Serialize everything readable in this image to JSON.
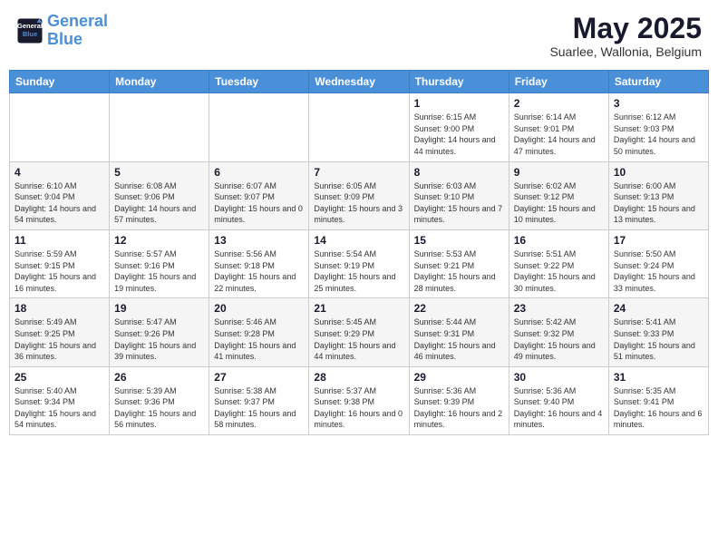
{
  "logo": {
    "line1": "General",
    "line2": "Blue"
  },
  "title": "May 2025",
  "subtitle": "Suarlee, Wallonia, Belgium",
  "headers": [
    "Sunday",
    "Monday",
    "Tuesday",
    "Wednesday",
    "Thursday",
    "Friday",
    "Saturday"
  ],
  "weeks": [
    [
      {
        "day": "",
        "info": ""
      },
      {
        "day": "",
        "info": ""
      },
      {
        "day": "",
        "info": ""
      },
      {
        "day": "",
        "info": ""
      },
      {
        "day": "1",
        "info": "Sunrise: 6:15 AM\nSunset: 9:00 PM\nDaylight: 14 hours\nand 44 minutes."
      },
      {
        "day": "2",
        "info": "Sunrise: 6:14 AM\nSunset: 9:01 PM\nDaylight: 14 hours\nand 47 minutes."
      },
      {
        "day": "3",
        "info": "Sunrise: 6:12 AM\nSunset: 9:03 PM\nDaylight: 14 hours\nand 50 minutes."
      }
    ],
    [
      {
        "day": "4",
        "info": "Sunrise: 6:10 AM\nSunset: 9:04 PM\nDaylight: 14 hours\nand 54 minutes."
      },
      {
        "day": "5",
        "info": "Sunrise: 6:08 AM\nSunset: 9:06 PM\nDaylight: 14 hours\nand 57 minutes."
      },
      {
        "day": "6",
        "info": "Sunrise: 6:07 AM\nSunset: 9:07 PM\nDaylight: 15 hours\nand 0 minutes."
      },
      {
        "day": "7",
        "info": "Sunrise: 6:05 AM\nSunset: 9:09 PM\nDaylight: 15 hours\nand 3 minutes."
      },
      {
        "day": "8",
        "info": "Sunrise: 6:03 AM\nSunset: 9:10 PM\nDaylight: 15 hours\nand 7 minutes."
      },
      {
        "day": "9",
        "info": "Sunrise: 6:02 AM\nSunset: 9:12 PM\nDaylight: 15 hours\nand 10 minutes."
      },
      {
        "day": "10",
        "info": "Sunrise: 6:00 AM\nSunset: 9:13 PM\nDaylight: 15 hours\nand 13 minutes."
      }
    ],
    [
      {
        "day": "11",
        "info": "Sunrise: 5:59 AM\nSunset: 9:15 PM\nDaylight: 15 hours\nand 16 minutes."
      },
      {
        "day": "12",
        "info": "Sunrise: 5:57 AM\nSunset: 9:16 PM\nDaylight: 15 hours\nand 19 minutes."
      },
      {
        "day": "13",
        "info": "Sunrise: 5:56 AM\nSunset: 9:18 PM\nDaylight: 15 hours\nand 22 minutes."
      },
      {
        "day": "14",
        "info": "Sunrise: 5:54 AM\nSunset: 9:19 PM\nDaylight: 15 hours\nand 25 minutes."
      },
      {
        "day": "15",
        "info": "Sunrise: 5:53 AM\nSunset: 9:21 PM\nDaylight: 15 hours\nand 28 minutes."
      },
      {
        "day": "16",
        "info": "Sunrise: 5:51 AM\nSunset: 9:22 PM\nDaylight: 15 hours\nand 30 minutes."
      },
      {
        "day": "17",
        "info": "Sunrise: 5:50 AM\nSunset: 9:24 PM\nDaylight: 15 hours\nand 33 minutes."
      }
    ],
    [
      {
        "day": "18",
        "info": "Sunrise: 5:49 AM\nSunset: 9:25 PM\nDaylight: 15 hours\nand 36 minutes."
      },
      {
        "day": "19",
        "info": "Sunrise: 5:47 AM\nSunset: 9:26 PM\nDaylight: 15 hours\nand 39 minutes."
      },
      {
        "day": "20",
        "info": "Sunrise: 5:46 AM\nSunset: 9:28 PM\nDaylight: 15 hours\nand 41 minutes."
      },
      {
        "day": "21",
        "info": "Sunrise: 5:45 AM\nSunset: 9:29 PM\nDaylight: 15 hours\nand 44 minutes."
      },
      {
        "day": "22",
        "info": "Sunrise: 5:44 AM\nSunset: 9:31 PM\nDaylight: 15 hours\nand 46 minutes."
      },
      {
        "day": "23",
        "info": "Sunrise: 5:42 AM\nSunset: 9:32 PM\nDaylight: 15 hours\nand 49 minutes."
      },
      {
        "day": "24",
        "info": "Sunrise: 5:41 AM\nSunset: 9:33 PM\nDaylight: 15 hours\nand 51 minutes."
      }
    ],
    [
      {
        "day": "25",
        "info": "Sunrise: 5:40 AM\nSunset: 9:34 PM\nDaylight: 15 hours\nand 54 minutes."
      },
      {
        "day": "26",
        "info": "Sunrise: 5:39 AM\nSunset: 9:36 PM\nDaylight: 15 hours\nand 56 minutes."
      },
      {
        "day": "27",
        "info": "Sunrise: 5:38 AM\nSunset: 9:37 PM\nDaylight: 15 hours\nand 58 minutes."
      },
      {
        "day": "28",
        "info": "Sunrise: 5:37 AM\nSunset: 9:38 PM\nDaylight: 16 hours\nand 0 minutes."
      },
      {
        "day": "29",
        "info": "Sunrise: 5:36 AM\nSunset: 9:39 PM\nDaylight: 16 hours\nand 2 minutes."
      },
      {
        "day": "30",
        "info": "Sunrise: 5:36 AM\nSunset: 9:40 PM\nDaylight: 16 hours\nand 4 minutes."
      },
      {
        "day": "31",
        "info": "Sunrise: 5:35 AM\nSunset: 9:41 PM\nDaylight: 16 hours\nand 6 minutes."
      }
    ]
  ]
}
